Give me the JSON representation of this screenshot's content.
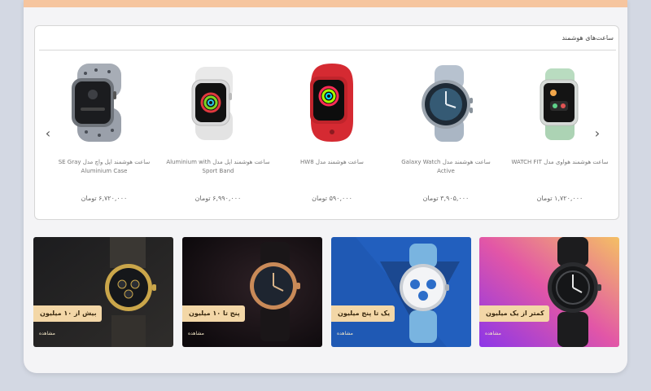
{
  "section": {
    "title": "ساعت‌های هوشمند",
    "prev_icon": "chevron-left-icon",
    "next_icon": "chevron-right-icon"
  },
  "products": [
    {
      "name": "ساعت هوشمند اپل واچ مدل SE Gray Aluminium Case",
      "price": "۶,۷۲۰,۰۰۰ تومان"
    },
    {
      "name": "ساعت هوشمند اپل مدل Aluminium with Sport Band",
      "price": "۶,۹۹۰,۰۰۰ تومان"
    },
    {
      "name": "ساعت هوشمند مدل HW8",
      "price": "۵۹۰,۰۰۰ تومان"
    },
    {
      "name": "ساعت هوشمند مدل Galaxy Watch Active",
      "price": "۳,۹۰۵,۰۰۰ تومان"
    },
    {
      "name": "ساعت هوشمند هواوی مدل WATCH FIT",
      "price": "۱,۷۲۰,۰۰۰ تومان"
    }
  ],
  "banners": [
    {
      "label": "بیش از ۱۰ میلیون",
      "link": "مشاهده"
    },
    {
      "label": "پنج تا ۱۰ میلیون",
      "link": "مشاهده"
    },
    {
      "label": "یک تا پنج میلیون",
      "link": "مشاهده"
    },
    {
      "label": "کمتر از یک میلیون",
      "link": "مشاهده"
    }
  ],
  "colors": {
    "top_bar": "#f6c59f",
    "tag_background": "#f3d7a7"
  }
}
